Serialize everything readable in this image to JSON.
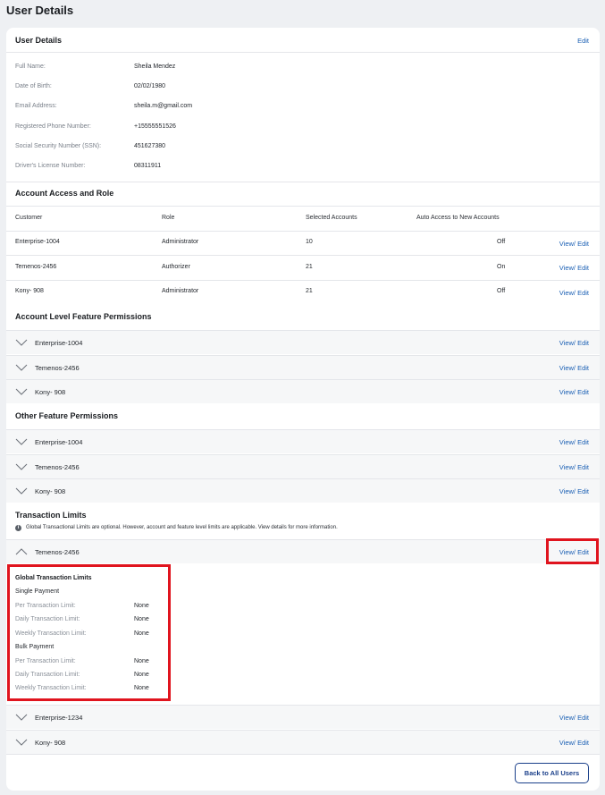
{
  "page_title": "User Details",
  "user_details": {
    "title": "User Details",
    "edit_label": "Edit",
    "fields": [
      {
        "label": "Full Name:",
        "value": "Sheila Mendez"
      },
      {
        "label": "Date of Birth:",
        "value": "02/02/1980"
      },
      {
        "label": "Email Address:",
        "value": "sheila.m@gmail.com"
      },
      {
        "label": "Registered Phone Number:",
        "value": "+15555551526"
      },
      {
        "label": "Social Security Number (SSN):",
        "value": "451627380"
      },
      {
        "label": "Driver's License Number:",
        "value": "08311911"
      }
    ]
  },
  "account_access": {
    "title": "Account Access and Role",
    "columns": [
      "Customer",
      "Role",
      "Selected Accounts",
      "Auto Access to New Accounts"
    ],
    "rows": [
      {
        "customer": "Enterprise-1004",
        "role": "Administrator",
        "selected": "10",
        "auto": "Off",
        "action": "View/ Edit"
      },
      {
        "customer": "Temenos-2456",
        "role": "Authorizer",
        "selected": "21",
        "auto": "On",
        "action": "View/ Edit"
      },
      {
        "customer": "Kony- 908",
        "role": "Administrator",
        "selected": "21",
        "auto": "Off",
        "action": "View/ Edit"
      }
    ]
  },
  "account_level": {
    "title": "Account Level Feature Permissions",
    "items": [
      {
        "name": "Enterprise-1004",
        "action": "View/ Edit"
      },
      {
        "name": "Temenos-2456",
        "action": "View/ Edit"
      },
      {
        "name": "Kony- 908",
        "action": "View/ Edit"
      }
    ]
  },
  "other_feature": {
    "title": "Other Feature Permissions",
    "items": [
      {
        "name": "Enterprise-1004",
        "action": "View/ Edit"
      },
      {
        "name": "Temenos-2456",
        "action": "View/ Edit"
      },
      {
        "name": "Kony- 908",
        "action": "View/ Edit"
      }
    ]
  },
  "transaction_limits": {
    "title": "Transaction Limits",
    "info": "Global Transactional Limits are optional. However, account and feature level limits are applicable. View details for more information.",
    "expanded": {
      "name": "Temenos-2456",
      "action": "View/ Edit",
      "global_title": "Global Transaction Limits",
      "single_payment": "Single Payment",
      "single": [
        {
          "label": "Per Transaction Limit:",
          "value": "None"
        },
        {
          "label": "Daily Transaction Limit:",
          "value": "None"
        },
        {
          "label": "Weekly Transaction Limit:",
          "value": "None"
        }
      ],
      "bulk_payment": "Bulk Payment",
      "bulk": [
        {
          "label": "Per Transaction Limit:",
          "value": "None"
        },
        {
          "label": "Daily Transaction Limit:",
          "value": "None"
        },
        {
          "label": "Weekly Transaction Limit:",
          "value": "None"
        }
      ]
    },
    "items": [
      {
        "name": "Enterprise-1234",
        "action": "View/ Edit"
      },
      {
        "name": "Kony- 908",
        "action": "View/ Edit"
      }
    ]
  },
  "back_button": "Back to All Users",
  "colors": {
    "link": "#1a5fb4",
    "highlight": "#e0141e",
    "primary_border": "#1a3f8a"
  }
}
